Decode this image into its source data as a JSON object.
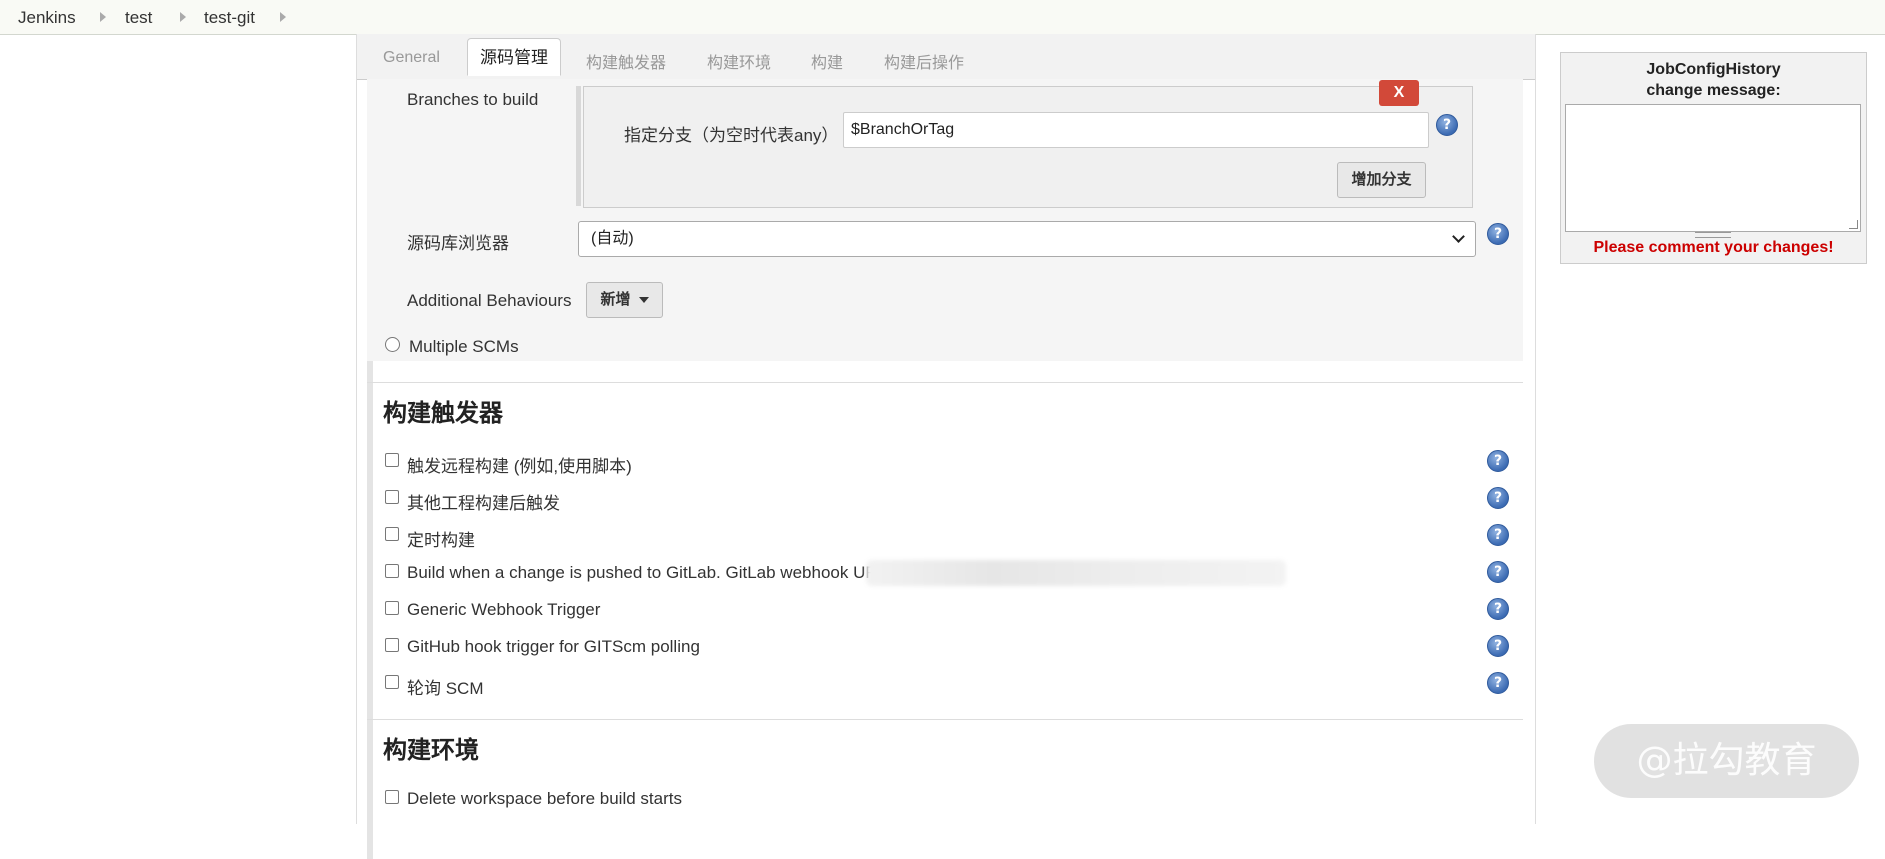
{
  "breadcrumb": {
    "items": [
      "Jenkins",
      "test",
      "test-git"
    ]
  },
  "tabs": [
    "General",
    "源码管理",
    "构建触发器",
    "构建环境",
    "构建",
    "构建后操作"
  ],
  "active_tab": "源码管理",
  "scm": {
    "branches_label": "Branches to build",
    "delete_label": "X",
    "branch_specifier_label": "指定分支（为空时代表any）",
    "branch_specifier_value": "$BranchOrTag",
    "add_branch_label": "增加分支",
    "repo_browser_label": "源码库浏览器",
    "repo_browser_value": "(自动)",
    "additional_behaviours_label": "Additional Behaviours",
    "add_button_label": "新增",
    "multiple_scms_label": "Multiple SCMs"
  },
  "build_triggers": {
    "title": "构建触发器",
    "options": [
      "触发远程构建 (例如,使用脚本)",
      "其他工程构建后触发",
      "定时构建",
      "Build when a change is pushed to GitLab. GitLab webhook URL",
      "Generic Webhook Trigger",
      "GitHub hook trigger for GITScm polling",
      "轮询 SCM"
    ]
  },
  "build_env": {
    "title": "构建环境",
    "options": [
      "Delete workspace before build starts"
    ]
  },
  "history": {
    "title_line1": "JobConfigHistory",
    "title_line2": "change message:",
    "warning": "Please comment your changes!"
  },
  "help_glyph": "?",
  "icons": {
    "help": "help-icon",
    "dropdown": "chevron-down-icon"
  },
  "colors": {
    "delete": "#d24939",
    "warning": "#cc0000",
    "help": "#3c6bb3"
  },
  "watermark": "@拉勾教育"
}
